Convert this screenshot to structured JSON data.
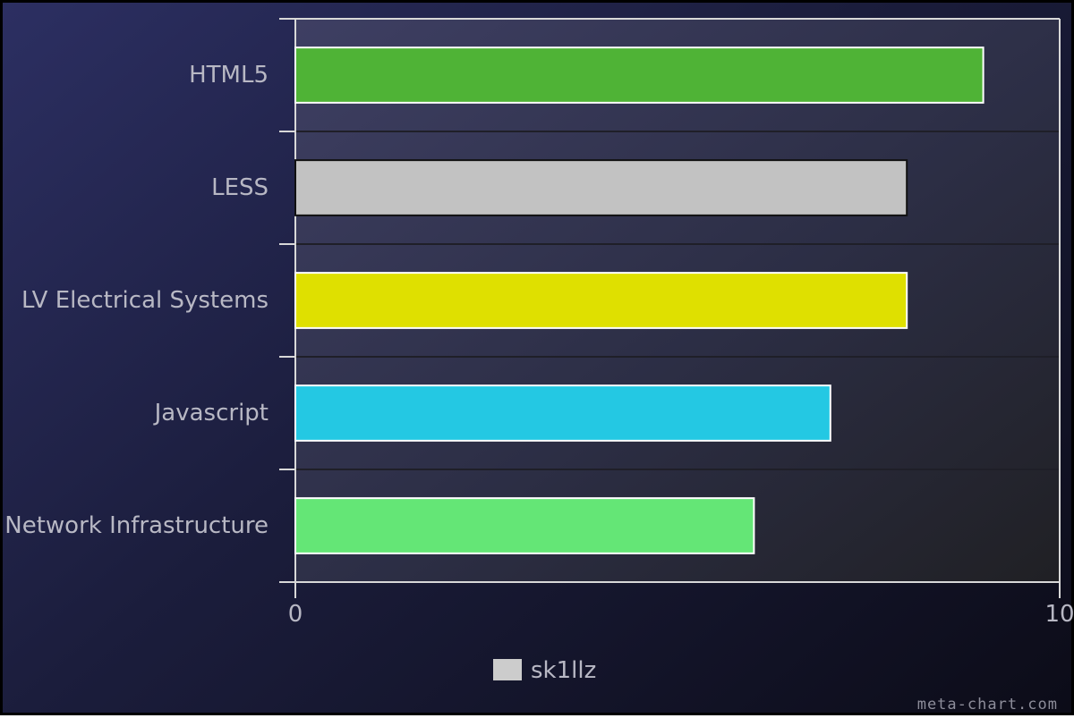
{
  "chart_data": {
    "type": "bar",
    "orientation": "horizontal",
    "categories": [
      "HTML5",
      "LESS",
      "LV Electrical Systems",
      "Javascript",
      "Network Infrastructure"
    ],
    "series": [
      {
        "name": "sk1llz",
        "values": [
          9,
          8,
          8,
          7,
          6
        ],
        "colors": [
          "#4fb336",
          "#c2c2c2",
          "#dfe000",
          "#24c8e3",
          "#64e676"
        ],
        "border_colors": [
          "#ffffff",
          "#111111",
          "#ffffff",
          "#ffffff",
          "#ffffff"
        ]
      }
    ],
    "x_ticks": [
      "0",
      "10"
    ],
    "xlim": [
      0,
      10
    ],
    "legend": {
      "position": "bottom",
      "label": "sk1llz",
      "swatch_color": "#cccccc"
    },
    "grid": true,
    "title": "",
    "xlabel": "",
    "ylabel": ""
  },
  "watermark": "meta-chart.com"
}
